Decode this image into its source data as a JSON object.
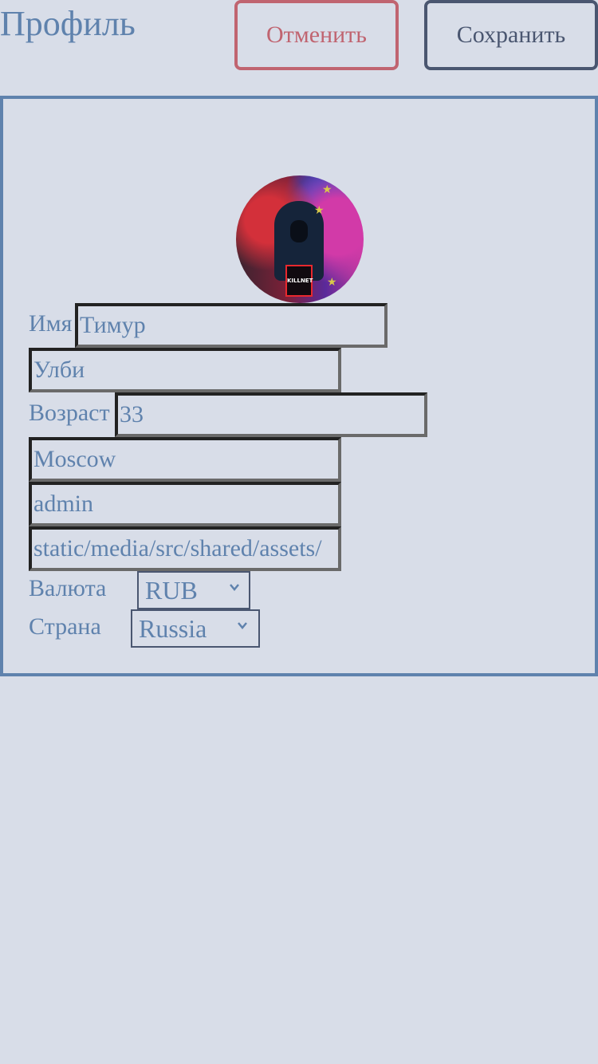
{
  "header": {
    "title": "Профиль",
    "cancel_label": "Отменить",
    "save_label": "Сохранить"
  },
  "profile": {
    "avatar_caption": "KILLNET",
    "first_name_label": "Имя",
    "first_name": "Тимур",
    "last_name": "Улби",
    "age_label": "Возраст",
    "age": "33",
    "city": "Moscow",
    "username": "admin",
    "avatar_url": "static/media/src/shared/assets/",
    "currency_label": "Валюта",
    "currency": "RUB",
    "country_label": "Страна",
    "country": "Russia"
  },
  "colors": {
    "background": "#d8dde8",
    "primary": "#5f82ad",
    "cancel": "#c06470",
    "save": "#4a5670"
  }
}
